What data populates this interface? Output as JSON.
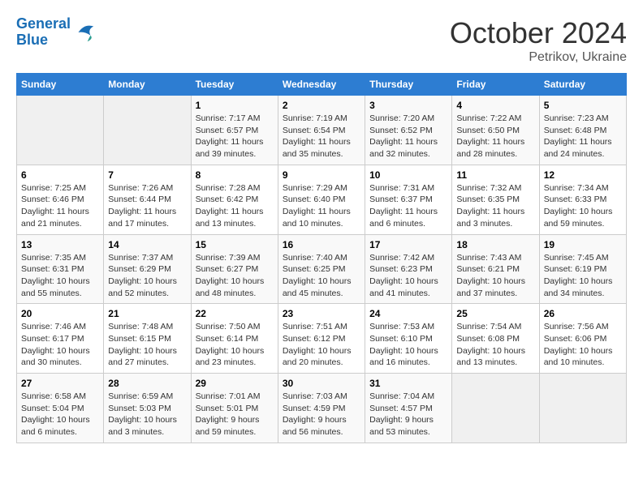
{
  "header": {
    "logo_line1": "General",
    "logo_line2": "Blue",
    "month": "October 2024",
    "location": "Petrikov, Ukraine"
  },
  "days_of_week": [
    "Sunday",
    "Monday",
    "Tuesday",
    "Wednesday",
    "Thursday",
    "Friday",
    "Saturday"
  ],
  "weeks": [
    [
      {
        "day": "",
        "info": ""
      },
      {
        "day": "",
        "info": ""
      },
      {
        "day": "1",
        "info": "Sunrise: 7:17 AM\nSunset: 6:57 PM\nDaylight: 11 hours and 39 minutes."
      },
      {
        "day": "2",
        "info": "Sunrise: 7:19 AM\nSunset: 6:54 PM\nDaylight: 11 hours and 35 minutes."
      },
      {
        "day": "3",
        "info": "Sunrise: 7:20 AM\nSunset: 6:52 PM\nDaylight: 11 hours and 32 minutes."
      },
      {
        "day": "4",
        "info": "Sunrise: 7:22 AM\nSunset: 6:50 PM\nDaylight: 11 hours and 28 minutes."
      },
      {
        "day": "5",
        "info": "Sunrise: 7:23 AM\nSunset: 6:48 PM\nDaylight: 11 hours and 24 minutes."
      }
    ],
    [
      {
        "day": "6",
        "info": "Sunrise: 7:25 AM\nSunset: 6:46 PM\nDaylight: 11 hours and 21 minutes."
      },
      {
        "day": "7",
        "info": "Sunrise: 7:26 AM\nSunset: 6:44 PM\nDaylight: 11 hours and 17 minutes."
      },
      {
        "day": "8",
        "info": "Sunrise: 7:28 AM\nSunset: 6:42 PM\nDaylight: 11 hours and 13 minutes."
      },
      {
        "day": "9",
        "info": "Sunrise: 7:29 AM\nSunset: 6:40 PM\nDaylight: 11 hours and 10 minutes."
      },
      {
        "day": "10",
        "info": "Sunrise: 7:31 AM\nSunset: 6:37 PM\nDaylight: 11 hours and 6 minutes."
      },
      {
        "day": "11",
        "info": "Sunrise: 7:32 AM\nSunset: 6:35 PM\nDaylight: 11 hours and 3 minutes."
      },
      {
        "day": "12",
        "info": "Sunrise: 7:34 AM\nSunset: 6:33 PM\nDaylight: 10 hours and 59 minutes."
      }
    ],
    [
      {
        "day": "13",
        "info": "Sunrise: 7:35 AM\nSunset: 6:31 PM\nDaylight: 10 hours and 55 minutes."
      },
      {
        "day": "14",
        "info": "Sunrise: 7:37 AM\nSunset: 6:29 PM\nDaylight: 10 hours and 52 minutes."
      },
      {
        "day": "15",
        "info": "Sunrise: 7:39 AM\nSunset: 6:27 PM\nDaylight: 10 hours and 48 minutes."
      },
      {
        "day": "16",
        "info": "Sunrise: 7:40 AM\nSunset: 6:25 PM\nDaylight: 10 hours and 45 minutes."
      },
      {
        "day": "17",
        "info": "Sunrise: 7:42 AM\nSunset: 6:23 PM\nDaylight: 10 hours and 41 minutes."
      },
      {
        "day": "18",
        "info": "Sunrise: 7:43 AM\nSunset: 6:21 PM\nDaylight: 10 hours and 37 minutes."
      },
      {
        "day": "19",
        "info": "Sunrise: 7:45 AM\nSunset: 6:19 PM\nDaylight: 10 hours and 34 minutes."
      }
    ],
    [
      {
        "day": "20",
        "info": "Sunrise: 7:46 AM\nSunset: 6:17 PM\nDaylight: 10 hours and 30 minutes."
      },
      {
        "day": "21",
        "info": "Sunrise: 7:48 AM\nSunset: 6:15 PM\nDaylight: 10 hours and 27 minutes."
      },
      {
        "day": "22",
        "info": "Sunrise: 7:50 AM\nSunset: 6:14 PM\nDaylight: 10 hours and 23 minutes."
      },
      {
        "day": "23",
        "info": "Sunrise: 7:51 AM\nSunset: 6:12 PM\nDaylight: 10 hours and 20 minutes."
      },
      {
        "day": "24",
        "info": "Sunrise: 7:53 AM\nSunset: 6:10 PM\nDaylight: 10 hours and 16 minutes."
      },
      {
        "day": "25",
        "info": "Sunrise: 7:54 AM\nSunset: 6:08 PM\nDaylight: 10 hours and 13 minutes."
      },
      {
        "day": "26",
        "info": "Sunrise: 7:56 AM\nSunset: 6:06 PM\nDaylight: 10 hours and 10 minutes."
      }
    ],
    [
      {
        "day": "27",
        "info": "Sunrise: 6:58 AM\nSunset: 5:04 PM\nDaylight: 10 hours and 6 minutes."
      },
      {
        "day": "28",
        "info": "Sunrise: 6:59 AM\nSunset: 5:03 PM\nDaylight: 10 hours and 3 minutes."
      },
      {
        "day": "29",
        "info": "Sunrise: 7:01 AM\nSunset: 5:01 PM\nDaylight: 9 hours and 59 minutes."
      },
      {
        "day": "30",
        "info": "Sunrise: 7:03 AM\nSunset: 4:59 PM\nDaylight: 9 hours and 56 minutes."
      },
      {
        "day": "31",
        "info": "Sunrise: 7:04 AM\nSunset: 4:57 PM\nDaylight: 9 hours and 53 minutes."
      },
      {
        "day": "",
        "info": ""
      },
      {
        "day": "",
        "info": ""
      }
    ]
  ]
}
